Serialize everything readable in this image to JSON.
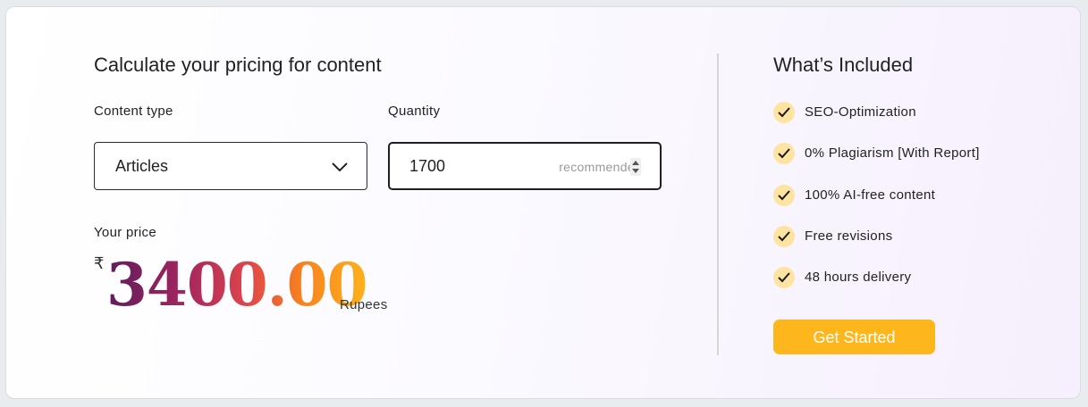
{
  "calculator": {
    "title": "Calculate your pricing for content",
    "content_type_label": "Content type",
    "content_type_value": "Articles",
    "quantity_label": "Quantity",
    "quantity_value": "1700",
    "quantity_hint": "recommended",
    "price_label": "Your price",
    "currency_symbol": "₹",
    "price_value": "3400.00",
    "price_unit": "Rupees"
  },
  "included": {
    "title": "What’s Included",
    "features": [
      "SEO-Optimization",
      "0% Plagiarism [With Report]",
      "100% AI-free content",
      "Free revisions",
      "48 hours delivery"
    ],
    "cta_label": "Get Started"
  },
  "colors": {
    "accent": "#fdb61c",
    "check_bg": "#ffe3a0",
    "price_gradient": [
      "#5e1d5c",
      "#a3265e",
      "#e0474a",
      "#f7821f",
      "#ffb21c"
    ]
  },
  "icons": {
    "dropdown": "chevron-down-icon",
    "spinner": "spinner-arrows-icon",
    "feature": "check-icon"
  }
}
